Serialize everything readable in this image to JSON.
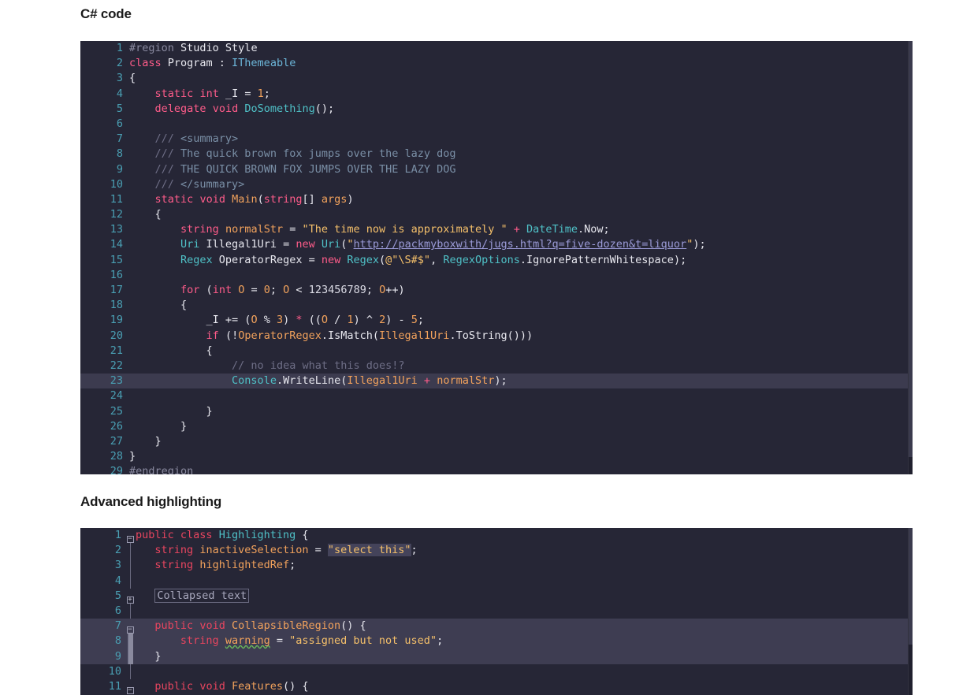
{
  "headings": {
    "csharp": "C# code",
    "advanced": "Advanced highlighting"
  },
  "theme": {
    "editor_background": "#262636",
    "line_number": "#4a9fb3",
    "keyword": "#ff5c8a",
    "type": "#4fc1c7",
    "variable": "#f2a25c",
    "string": "#f5c06a",
    "comment": "#6e6e86",
    "plain": "#e8e8ef",
    "link": "#9b9bd8",
    "current_line_highlight": "#3c3b4f",
    "region_highlight": "#3e3d52",
    "warning_squiggle": "#6aba5a"
  },
  "csharp_block": {
    "language": "csharp",
    "first_line": 1,
    "last_line": 29,
    "highlighted_line": 23,
    "lines": [
      {
        "n": "1",
        "text": "#region Studio Style"
      },
      {
        "n": "2",
        "text": "class Program : IThemeable"
      },
      {
        "n": "3",
        "text": "{"
      },
      {
        "n": "4",
        "text": "    static int _I = 1;"
      },
      {
        "n": "5",
        "text": "    delegate void DoSomething();"
      },
      {
        "n": "6",
        "text": ""
      },
      {
        "n": "7",
        "text": "    /// <summary>"
      },
      {
        "n": "8",
        "text": "    /// The quick brown fox jumps over the lazy dog"
      },
      {
        "n": "9",
        "text": "    /// THE QUICK BROWN FOX JUMPS OVER THE LAZY DOG"
      },
      {
        "n": "10",
        "text": "    /// </summary>"
      },
      {
        "n": "11",
        "text": "    static void Main(string[] args)"
      },
      {
        "n": "12",
        "text": "    {"
      },
      {
        "n": "13",
        "text": "        string normalStr = \"The time now is approximately \" + DateTime.Now;"
      },
      {
        "n": "14",
        "text": "        Uri Illegal1Uri = new Uri(\"http://packmyboxwith/jugs.html?q=five-dozen&t=liquor\");"
      },
      {
        "n": "15",
        "text": "        Regex OperatorRegex = new Regex(@\"\\S#$\", RegexOptions.IgnorePatternWhitespace);"
      },
      {
        "n": "16",
        "text": ""
      },
      {
        "n": "17",
        "text": "        for (int O = 0; O < 123456789; O++)"
      },
      {
        "n": "18",
        "text": "        {"
      },
      {
        "n": "19",
        "text": "            _I += (O % 3) * ((O / 1) ^ 2) - 5;"
      },
      {
        "n": "20",
        "text": "            if (!OperatorRegex.IsMatch(Illegal1Uri.ToString()))"
      },
      {
        "n": "21",
        "text": "            {"
      },
      {
        "n": "22",
        "text": "                // no idea what this does!?"
      },
      {
        "n": "23",
        "text": "                Console.WriteLine(Illegal1Uri + normalStr);"
      },
      {
        "n": "24",
        "text": ""
      },
      {
        "n": "25",
        "text": "            }"
      },
      {
        "n": "26",
        "text": "        }"
      },
      {
        "n": "27",
        "text": "    }"
      },
      {
        "n": "28",
        "text": "}"
      },
      {
        "n": "29",
        "text": "#endregion"
      }
    ]
  },
  "advanced_block": {
    "language": "java",
    "first_line": 1,
    "last_line": 11,
    "collapsed_placeholder": "Collapsed text",
    "highlighted_lines": [
      7,
      8,
      9
    ],
    "warning_token": "warning",
    "selected_token": "select this",
    "lines": [
      {
        "n": "1",
        "text": "public class Highlighting {",
        "fold": "minus"
      },
      {
        "n": "2",
        "text": "    string inactiveSelection = \"select this\";",
        "fold": "bar"
      },
      {
        "n": "3",
        "text": "    string highlightedRef;",
        "fold": "bar"
      },
      {
        "n": "4",
        "text": "",
        "fold": "bar"
      },
      {
        "n": "5",
        "text": "    Collapsed text",
        "fold": "plus"
      },
      {
        "n": "6",
        "text": "",
        "fold": "bar"
      },
      {
        "n": "7",
        "text": "    public void CollapsibleRegion() {",
        "fold": "minus-active"
      },
      {
        "n": "8",
        "text": "        string warning = \"assigned but not used\";",
        "fold": "gbar"
      },
      {
        "n": "9",
        "text": "    }",
        "fold": "gbar"
      },
      {
        "n": "10",
        "text": "",
        "fold": "bar"
      },
      {
        "n": "11",
        "text": "    public void Features() {",
        "fold": "minus"
      }
    ]
  }
}
